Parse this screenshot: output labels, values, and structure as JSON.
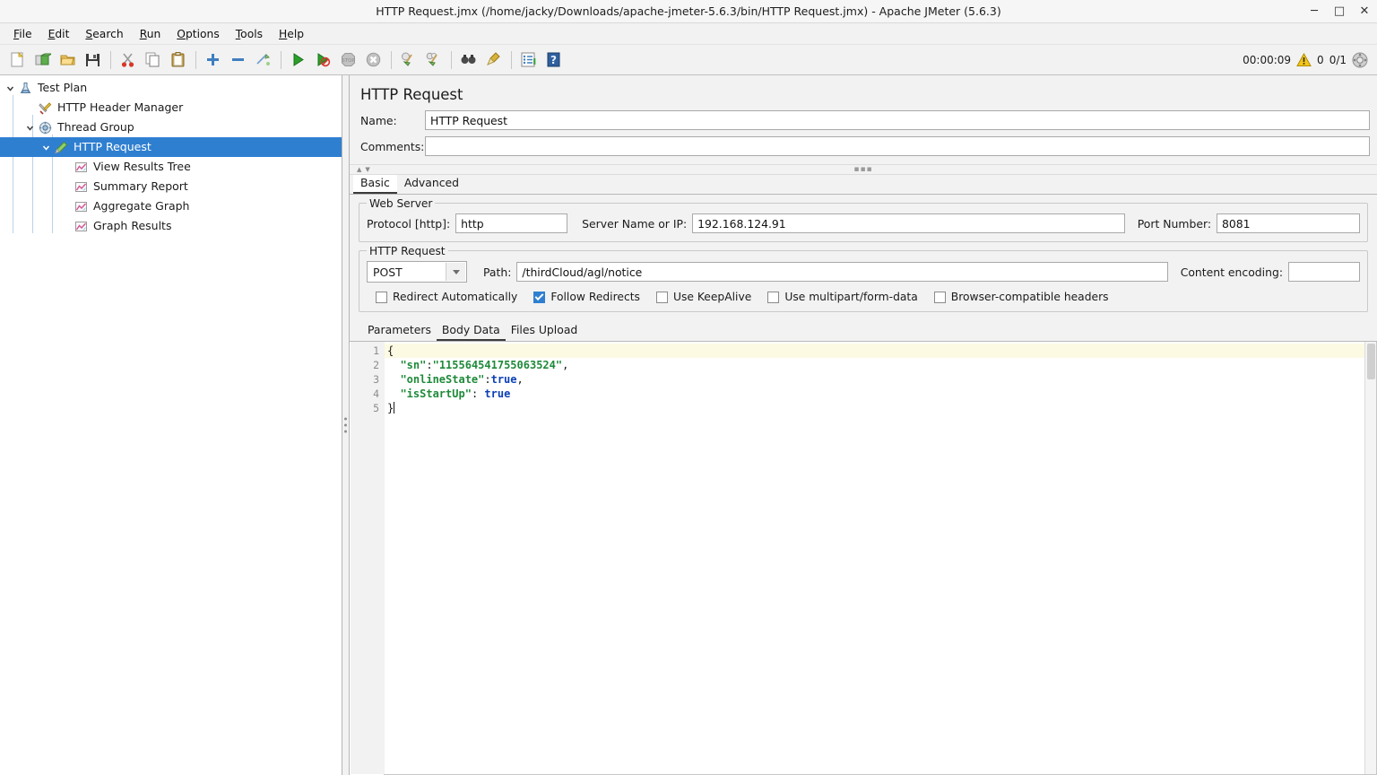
{
  "window": {
    "title": "HTTP Request.jmx (/home/jacky/Downloads/apache-jmeter-5.6.3/bin/HTTP Request.jmx) - Apache JMeter (5.6.3)",
    "minimize": "─",
    "maximize": "□",
    "close": "✕"
  },
  "menubar": {
    "items": [
      {
        "label": "File",
        "mnemonic": "F"
      },
      {
        "label": "Edit",
        "mnemonic": "E"
      },
      {
        "label": "Search",
        "mnemonic": "S"
      },
      {
        "label": "Run",
        "mnemonic": "R"
      },
      {
        "label": "Options",
        "mnemonic": "O"
      },
      {
        "label": "Tools",
        "mnemonic": "T"
      },
      {
        "label": "Help",
        "mnemonic": "H"
      }
    ]
  },
  "toolbar": {
    "buttons": [
      {
        "name": "new-icon",
        "tooltip": "New"
      },
      {
        "name": "templates-icon",
        "tooltip": "Templates"
      },
      {
        "name": "open-icon",
        "tooltip": "Open"
      },
      {
        "name": "save-icon",
        "tooltip": "Save"
      },
      {
        "name": "cut-icon",
        "tooltip": "Cut"
      },
      {
        "name": "copy-icon",
        "tooltip": "Copy"
      },
      {
        "name": "paste-icon",
        "tooltip": "Paste"
      },
      {
        "name": "expand-all-icon",
        "tooltip": "Expand All"
      },
      {
        "name": "collapse-all-icon",
        "tooltip": "Collapse All"
      },
      {
        "name": "toggle-icon",
        "tooltip": "Toggle"
      },
      {
        "name": "start-icon",
        "tooltip": "Start"
      },
      {
        "name": "start-no-pauses-icon",
        "tooltip": "Start no pauses"
      },
      {
        "name": "stop-icon",
        "tooltip": "Stop"
      },
      {
        "name": "shutdown-icon",
        "tooltip": "Shutdown"
      },
      {
        "name": "clear-icon",
        "tooltip": "Clear"
      },
      {
        "name": "clear-all-icon",
        "tooltip": "Clear All"
      },
      {
        "name": "search-icon",
        "tooltip": "Search"
      },
      {
        "name": "reset-search-icon",
        "tooltip": "Reset Search"
      },
      {
        "name": "function-helper-icon",
        "tooltip": "Function Helper Dialog"
      },
      {
        "name": "help-icon",
        "tooltip": "Help"
      }
    ],
    "status": {
      "elapsed": "00:00:09",
      "warning_icon": "warning-triangle-icon",
      "warning_count": "0",
      "threads": "0/1",
      "remote_icon": "remote-engines-icon"
    }
  },
  "tree": {
    "nodes": [
      {
        "label": "Test Plan",
        "icon": "test-plan-icon",
        "depth": 0,
        "expanded": true,
        "selected": false
      },
      {
        "label": "HTTP Header Manager",
        "icon": "header-manager-icon",
        "depth": 1,
        "expanded": null,
        "selected": false
      },
      {
        "label": "Thread Group",
        "icon": "thread-group-icon",
        "depth": 1,
        "expanded": true,
        "selected": false
      },
      {
        "label": "HTTP Request",
        "icon": "http-request-icon",
        "depth": 2,
        "expanded": true,
        "selected": true
      },
      {
        "label": "View Results Tree",
        "icon": "listener-icon",
        "depth": 3,
        "expanded": null,
        "selected": false
      },
      {
        "label": "Summary Report",
        "icon": "listener-icon",
        "depth": 3,
        "expanded": null,
        "selected": false
      },
      {
        "label": "Aggregate Graph",
        "icon": "listener-icon",
        "depth": 3,
        "expanded": null,
        "selected": false
      },
      {
        "label": "Graph Results",
        "icon": "listener-icon",
        "depth": 3,
        "expanded": null,
        "selected": false
      }
    ]
  },
  "panel": {
    "title": "HTTP Request",
    "name_label": "Name:",
    "name_value": "HTTP Request",
    "comments_label": "Comments:",
    "comments_value": "",
    "tabs": [
      {
        "label": "Basic",
        "active": true
      },
      {
        "label": "Advanced",
        "active": false
      }
    ],
    "web_server": {
      "legend": "Web Server",
      "protocol_label": "Protocol [http]:",
      "protocol_value": "http",
      "server_label": "Server Name or IP:",
      "server_value": "192.168.124.91",
      "port_label": "Port Number:",
      "port_value": "8081"
    },
    "http_request": {
      "legend": "HTTP Request",
      "method_value": "POST",
      "path_label": "Path:",
      "path_value": "/thirdCloud/agl/notice",
      "encoding_label": "Content encoding:",
      "encoding_value": "",
      "checkboxes": [
        {
          "label": "Redirect Automatically",
          "checked": false
        },
        {
          "label": "Follow Redirects",
          "checked": true
        },
        {
          "label": "Use KeepAlive",
          "checked": false
        },
        {
          "label": "Use multipart/form-data",
          "checked": false
        },
        {
          "label": "Browser-compatible headers",
          "checked": false
        }
      ]
    },
    "body_tabs": [
      {
        "label": "Parameters",
        "active": false
      },
      {
        "label": "Body Data",
        "active": true
      },
      {
        "label": "Files Upload",
        "active": false
      }
    ],
    "body_editor": {
      "line_numbers": [
        "1",
        "2",
        "3",
        "4",
        "5"
      ],
      "lines": [
        {
          "n": "1",
          "current": true,
          "tokens": [
            {
              "t": "{",
              "c": "punct"
            }
          ]
        },
        {
          "n": "2",
          "current": false,
          "tokens": [
            {
              "t": "  ",
              "c": "punct"
            },
            {
              "t": "\"sn\"",
              "c": "str"
            },
            {
              "t": ":",
              "c": "punct"
            },
            {
              "t": "\"115564541755063524\"",
              "c": "str"
            },
            {
              "t": ",",
              "c": "punct"
            }
          ]
        },
        {
          "n": "3",
          "current": false,
          "tokens": [
            {
              "t": "  ",
              "c": "punct"
            },
            {
              "t": "\"onlineState\"",
              "c": "str"
            },
            {
              "t": ":",
              "c": "punct"
            },
            {
              "t": "true",
              "c": "bool"
            },
            {
              "t": ",",
              "c": "punct"
            }
          ]
        },
        {
          "n": "4",
          "current": false,
          "tokens": [
            {
              "t": "  ",
              "c": "punct"
            },
            {
              "t": "\"isStartUp\"",
              "c": "str"
            },
            {
              "t": ": ",
              "c": "punct"
            },
            {
              "t": "true",
              "c": "bool"
            }
          ]
        },
        {
          "n": "5",
          "current": false,
          "tokens": [
            {
              "t": "}",
              "c": "punct"
            }
          ]
        }
      ]
    }
  },
  "colors": {
    "selection_blue": "#2f7fd1",
    "current_line": "#fdfae4",
    "json_string": "#1f8a3a",
    "json_boolean": "#0b3fb5",
    "panel_bg": "#f2f2f2"
  }
}
